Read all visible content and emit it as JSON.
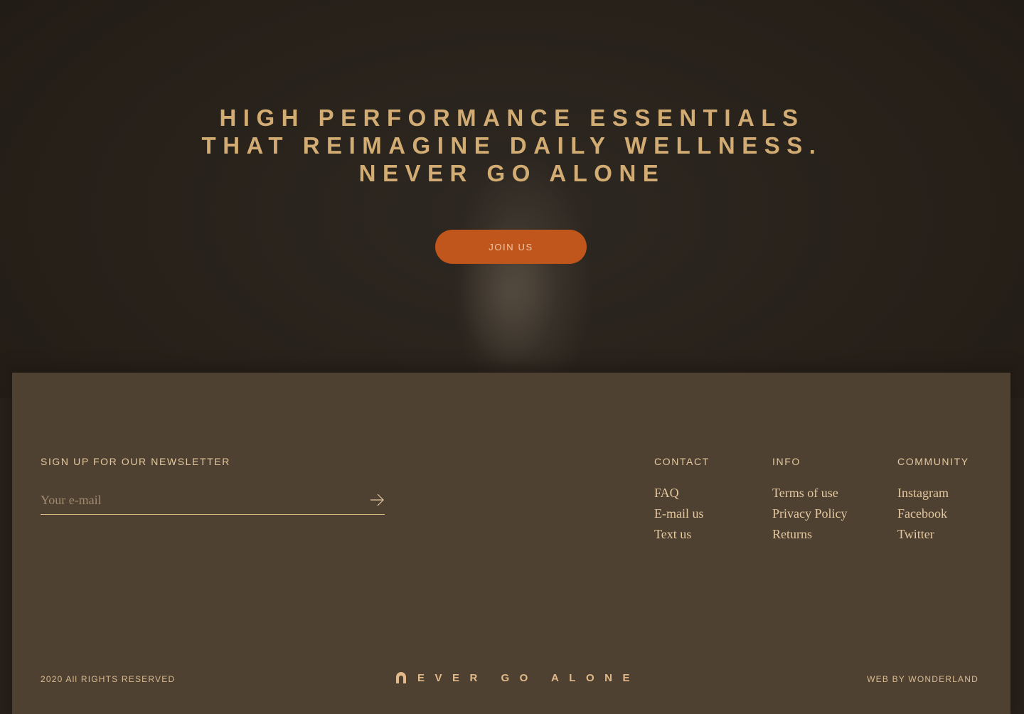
{
  "hero": {
    "headline": [
      "HIGH PERFORMANCE ESSENTIALS",
      "THAT REIMAGINE DAILY WELLNESS.",
      "NEVER GO ALONE"
    ],
    "cta_label": "JOIN US"
  },
  "newsletter": {
    "title": "SIGN UP FOR OUR NEWSLETTER",
    "email_placeholder": "Your e-mail",
    "email_value": "",
    "submit_icon": "arrow-right-icon"
  },
  "columns": [
    {
      "title": "CONTACT",
      "links": [
        "FAQ",
        "E-mail us",
        "Text us"
      ]
    },
    {
      "title": "INFO",
      "links": [
        "Terms of use",
        "Privacy Policy",
        "Returns"
      ]
    },
    {
      "title": "COMMUNITY",
      "links": [
        "Instagram",
        "Facebook",
        "Twitter"
      ]
    }
  ],
  "footer": {
    "copyright": "2020 All RIGHTS RESERVED",
    "brand_text": "EVER GO ALONE",
    "brand_icon": "arch-logo-icon",
    "credit": "WEB BY WONDERLAND"
  },
  "colors": {
    "hero_bg": "#272019",
    "footer_bg": "#4f4132",
    "accent": "#c0561b",
    "gold_text": "#d2ac73"
  }
}
